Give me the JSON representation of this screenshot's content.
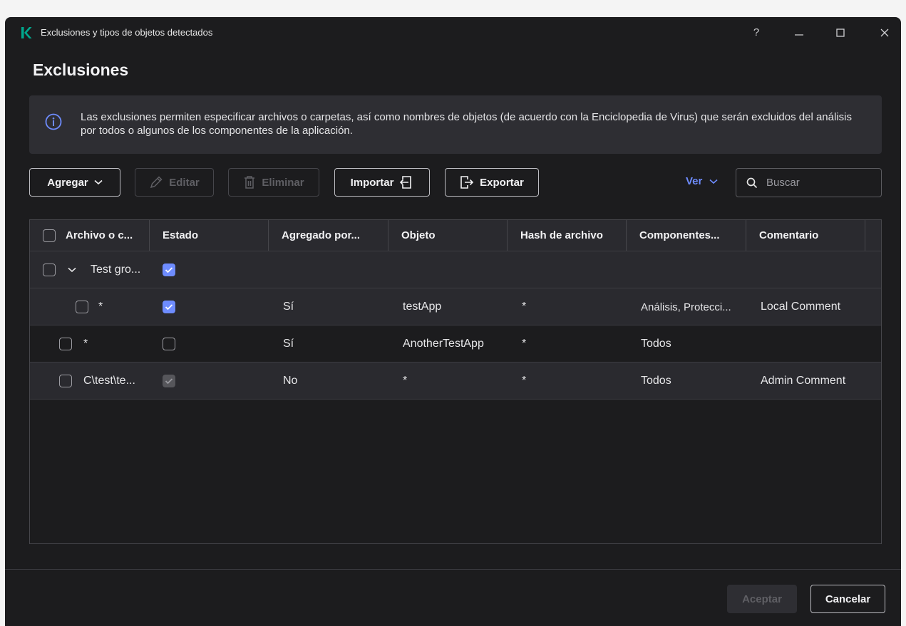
{
  "window": {
    "title": "Exclusiones y tipos de objetos detectados",
    "help": "?"
  },
  "page_title": "Exclusiones",
  "info_text": "Las exclusiones permiten especificar archivos o carpetas, así como nombres de objetos (de acuerdo con la Enciclopedia de Virus) que serán excluidos del análisis por todos o algunos de los componentes de la aplicación.",
  "toolbar": {
    "add": "Agregar",
    "edit": "Editar",
    "delete": "Eliminar",
    "import": "Importar",
    "export": "Exportar",
    "view": "Ver",
    "search_placeholder": "Buscar"
  },
  "table": {
    "headers": [
      "Archivo o c...",
      "Estado",
      "Agregado por...",
      "Objeto",
      "Hash de archivo",
      "Componentes...",
      "Comentario"
    ],
    "rows": [
      {
        "file": "Test gro...",
        "added_by": "",
        "object": "",
        "hash": "",
        "components": "",
        "comment": ""
      },
      {
        "file": "*",
        "added_by": "Sí",
        "object": "testApp",
        "hash": "*",
        "components": "Análisis, Protecci...",
        "comment": "Local Comment"
      },
      {
        "file": "*",
        "added_by": "Sí",
        "object": "AnotherTestApp",
        "hash": "*",
        "components": "Todos",
        "comment": ""
      },
      {
        "file": "C\\test\\te...",
        "added_by": "No",
        "object": "*",
        "hash": "*",
        "components": "Todos",
        "comment": "Admin Comment"
      }
    ]
  },
  "footer": {
    "ok": "Aceptar",
    "cancel": "Cancelar"
  },
  "colors": {
    "accent": "#6e8cff",
    "background": "#1c1c1e",
    "panel": "#2e2e33",
    "brand": "#00a88e"
  }
}
